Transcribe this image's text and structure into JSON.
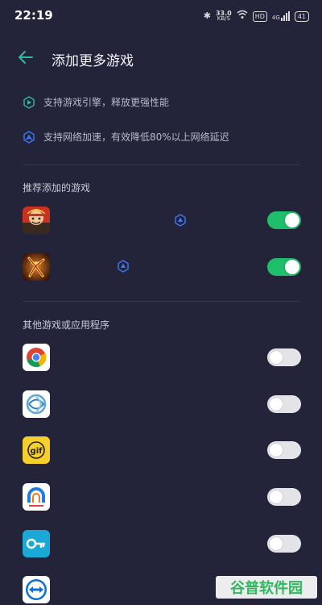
{
  "status_bar": {
    "time": "22:19",
    "speed_value": "33.0",
    "speed_unit": "KB/S",
    "hd_label": "HD",
    "network_label": "4G",
    "battery": "41"
  },
  "header": {
    "title": "添加更多游戏",
    "back_icon": "arrow-left-icon"
  },
  "features": [
    {
      "icon": "game-engine-icon",
      "text": "支持游戏引擎，释放更强性能",
      "color": "#2fb8a6"
    },
    {
      "icon": "network-boost-icon",
      "text": "支持网络加速，有效降低80%以上网络延迟",
      "color": "#3d7bf2"
    }
  ],
  "sections": {
    "recommended_title": "推荐添加的游戏",
    "other_title": "其他游戏或应用程序"
  },
  "recommended_apps": [
    {
      "icon": "one-piece-game-icon",
      "network_badge": true,
      "enabled": true
    },
    {
      "icon": "kill-game-icon",
      "network_badge": true,
      "enabled": true
    }
  ],
  "other_apps": [
    {
      "icon": "chrome-icon",
      "enabled": false
    },
    {
      "icon": "swirl-app-icon",
      "enabled": false
    },
    {
      "icon": "gif-app-icon",
      "enabled": false
    },
    {
      "icon": "arch-app-icon",
      "enabled": false
    },
    {
      "icon": "key-app-icon",
      "enabled": false
    },
    {
      "icon": "teamviewer-icon",
      "enabled": false
    }
  ],
  "watermark": {
    "text": "谷普软件园",
    "color": "#2eb85c"
  },
  "colors": {
    "background": "#23233a",
    "toggle_on": "#1fbe6b",
    "toggle_off": "#e4e4e8",
    "accent_teal": "#2fb8a6"
  }
}
